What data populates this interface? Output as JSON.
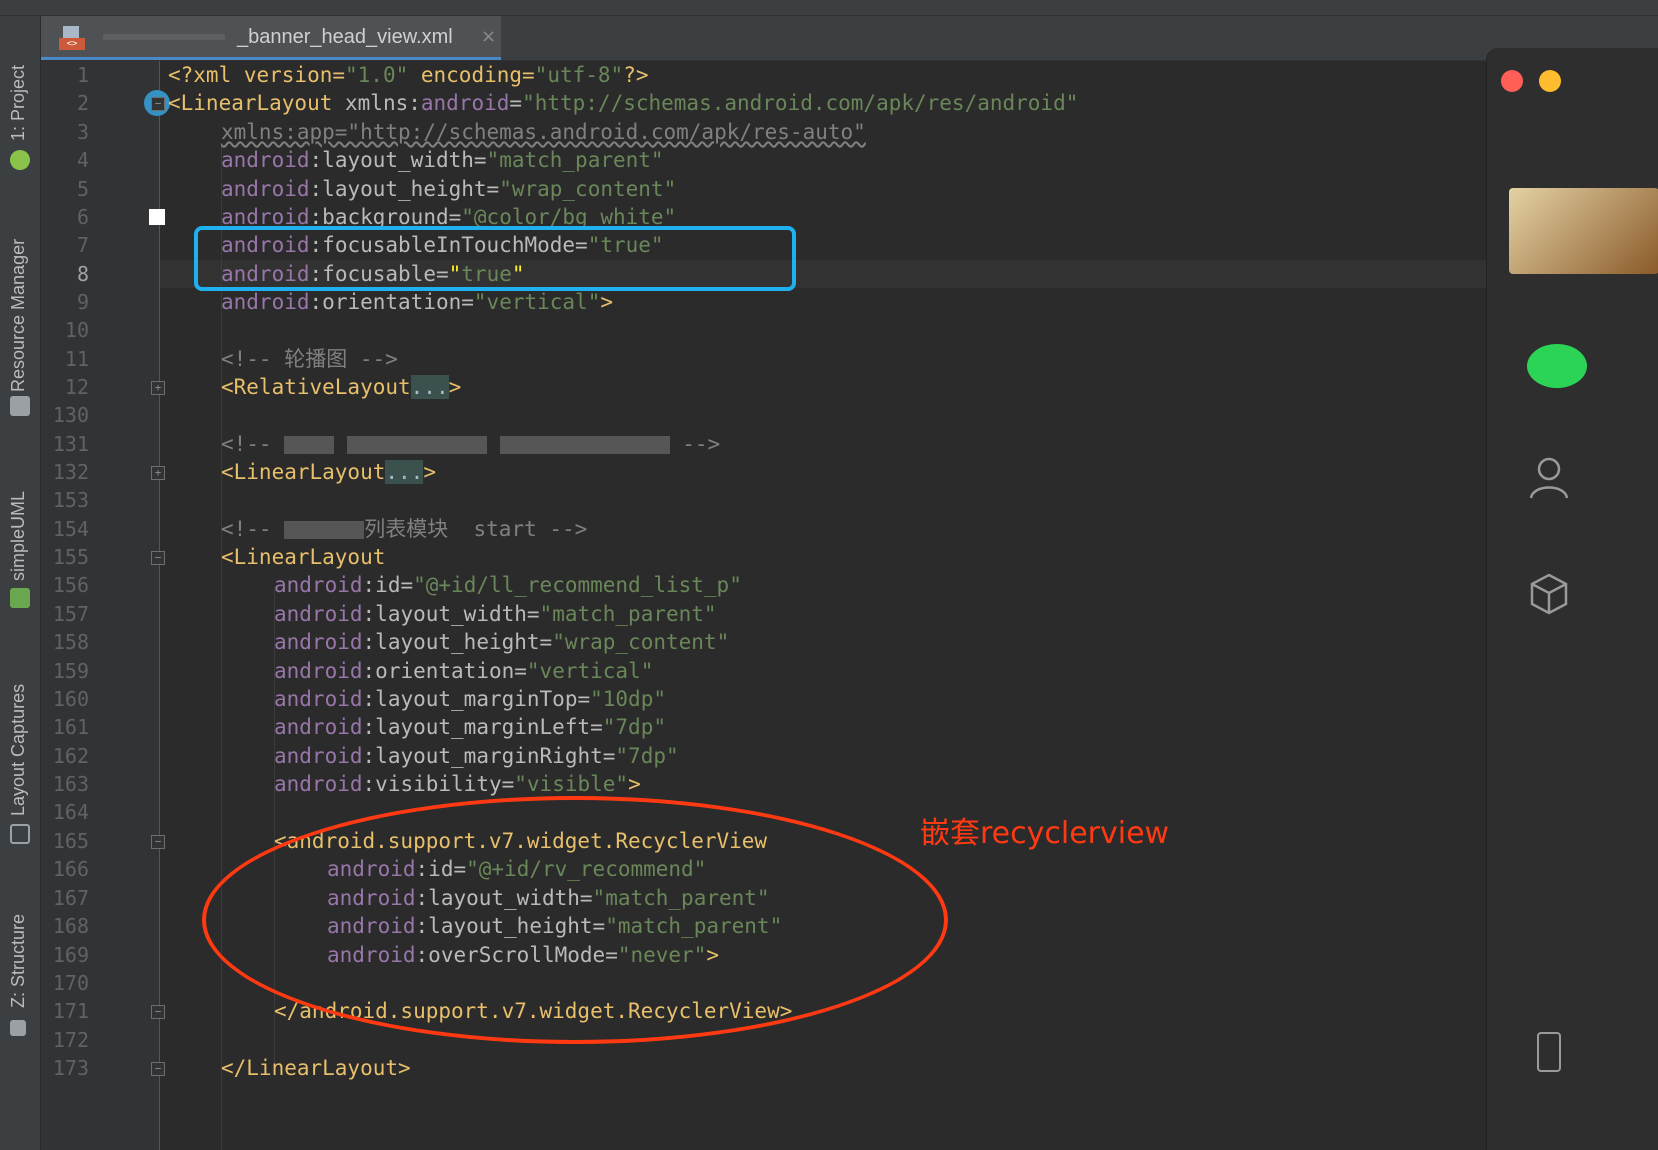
{
  "tab": {
    "filename": "_banner_head_view.xml",
    "close": "×"
  },
  "toolbar": {
    "project": "1: Project",
    "resource_manager": "Resource Manager",
    "simpleuml": "simpleUML",
    "layout_captures": "Layout Captures",
    "structure": "Z: Structure"
  },
  "gutter": {
    "line_numbers": [
      "1",
      "2",
      "3",
      "4",
      "5",
      "6",
      "7",
      "8",
      "9",
      "10",
      "11",
      "12",
      "130",
      "131",
      "132",
      "153",
      "154",
      "155",
      "156",
      "157",
      "158",
      "159",
      "160",
      "161",
      "162",
      "163",
      "164",
      "165",
      "166",
      "167",
      "168",
      "169",
      "170",
      "171",
      "172",
      "173"
    ],
    "current_line": "8",
    "class_badge": "C"
  },
  "code": {
    "l1": {
      "a": "<?xml version=",
      "b": "\"1.0\"",
      "c": " encoding=",
      "d": "\"utf-8\"",
      "e": "?>"
    },
    "l2": {
      "tag": "<LinearLayout",
      "attr": " xmlns:",
      "ns": "android",
      "eq": "=",
      "val": "\"http://schemas.android.com/apk/res/android\""
    },
    "l3": {
      "text": "xmlns:app=\"http://schemas.android.com/apk/res-auto\""
    },
    "l4": {
      "ns": "android",
      ":": ":",
      "attr": "layout_width",
      "eq": "=",
      "val": "\"match_parent\""
    },
    "l5": {
      "ns": "android",
      ":": ":",
      "attr": "layout_height",
      "eq": "=",
      "val": "\"wrap_content\""
    },
    "l6": {
      "ns": "android",
      ":": ":",
      "attr": "background",
      "eq": "=",
      "val": "\"@color/bg_white\""
    },
    "l7": {
      "ns": "android",
      ":": ":",
      "attr": "focusableInTouchMode",
      "eq": "=",
      "val": "\"true\""
    },
    "l8": {
      "ns": "android",
      ":": ":",
      "attr": "focusable",
      "eq": "=",
      "val1": "\"",
      "val2": "true",
      "val3": "\""
    },
    "l9": {
      "ns": "android",
      ":": ":",
      "attr": "orientation",
      "eq": "=",
      "val": "\"vertical\"",
      "end": ">"
    },
    "l11": {
      "text": "<!-- 轮播图 -->"
    },
    "l12": {
      "tag": "<RelativeLayout",
      "fold": "...",
      "end": ">"
    },
    "l131": {
      "a": "<!--",
      "b": "-->"
    },
    "l132": {
      "tag": "<LinearLayout",
      "fold": "...",
      "end": ">"
    },
    "l154": {
      "a": "<!--",
      "b": "列表模块  start -->"
    },
    "l155": {
      "tag": "<LinearLayout"
    },
    "l156": {
      "ns": "android",
      "attr": "id",
      "val": "\"@+id/ll_recommend_list_p\""
    },
    "l157": {
      "ns": "android",
      "attr": "layout_width",
      "val": "\"match_parent\""
    },
    "l158": {
      "ns": "android",
      "attr": "layout_height",
      "val": "\"wrap_content\""
    },
    "l159": {
      "ns": "android",
      "attr": "orientation",
      "val": "\"vertical\""
    },
    "l160": {
      "ns": "android",
      "attr": "layout_marginTop",
      "val": "\"10dp\""
    },
    "l161": {
      "ns": "android",
      "attr": "layout_marginLeft",
      "val": "\"7dp\""
    },
    "l162": {
      "ns": "android",
      "attr": "layout_marginRight",
      "val": "\"7dp\""
    },
    "l163": {
      "ns": "android",
      "attr": "visibility",
      "val": "\"visible\"",
      "end": ">"
    },
    "l165": {
      "tag": "<android.support.v7.widget.RecyclerView"
    },
    "l166": {
      "ns": "android",
      "attr": "id",
      "val": "\"@+id/rv_recommend\""
    },
    "l167": {
      "ns": "android",
      "attr": "layout_width",
      "val": "\"match_parent\""
    },
    "l168": {
      "ns": "android",
      "attr": "layout_height",
      "val": "\"match_parent\""
    },
    "l169": {
      "ns": "android",
      "attr": "overScrollMode",
      "val": "\"never\"",
      "end": ">"
    },
    "l171": {
      "tag": "</android.support.v7.widget.RecyclerView>"
    },
    "l173": {
      "tag": "</LinearLayout>"
    }
  },
  "annotation": {
    "text": "嵌套recyclerview",
    "color": "#ff3a12"
  },
  "highlight_box_color": "#1fb0f0"
}
